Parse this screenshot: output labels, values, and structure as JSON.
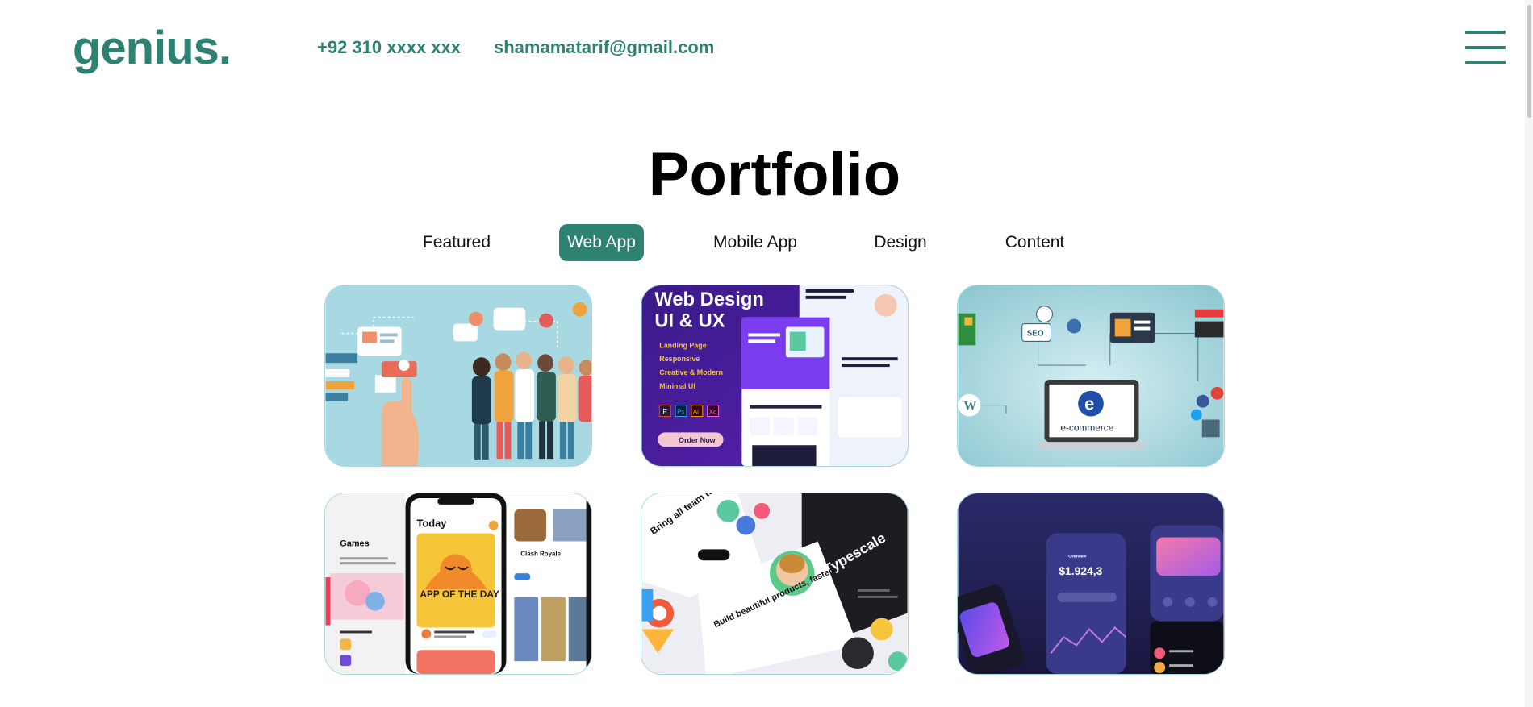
{
  "header": {
    "logo": "genius.",
    "phone": "+92 310 xxxx xxx",
    "email": "shamamatarif@gmail.com",
    "menu_icon": "hamburger-icon"
  },
  "page_title": "Portfolio",
  "tabs": [
    {
      "label": "Featured",
      "active": false
    },
    {
      "label": "Web App",
      "active": true
    },
    {
      "label": "Mobile App",
      "active": false
    },
    {
      "label": "Design",
      "active": false
    },
    {
      "label": "Content",
      "active": false
    }
  ],
  "colors": {
    "accent": "#2e8272"
  },
  "portfolio": [
    {
      "name": "team-illustration"
    },
    {
      "name": "web-design-banner",
      "heading_1": "Web Design",
      "heading_2": "UI & UX",
      "bullets": [
        "Landing Page",
        "Responsive",
        "Creative & Modern",
        "Minimal UI"
      ],
      "tools": [
        "F",
        "Ps",
        "Ai",
        "Xd"
      ],
      "cta": "Order Now"
    },
    {
      "name": "ecommerce-illustration",
      "seo": "SEO",
      "screen": "e-commerce"
    },
    {
      "name": "app-store-mockup",
      "left_heading": "Games",
      "center_heading": "Today",
      "feature": "APP OF THE DAY",
      "right_heading": "Clash Royale"
    },
    {
      "name": "ui-collage",
      "tag_1": "Bring all team together",
      "tag_2": "Build beautiful products, faster.",
      "tag_3": "Typescale"
    },
    {
      "name": "finance-app-mockup",
      "balance": "$1.924,3"
    }
  ]
}
